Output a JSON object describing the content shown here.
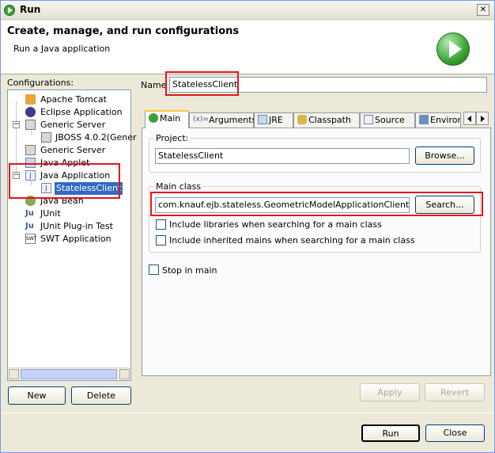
{
  "window": {
    "title": "Run",
    "close_glyph": "✕"
  },
  "header": {
    "title": "Create, manage, and run configurations",
    "subtitle": "Run a Java application",
    "icon": "run-icon"
  },
  "left": {
    "configurations_label": "Configurations:",
    "items": [
      {
        "label": "Apache Tomcat",
        "icon": "tomcat-icon"
      },
      {
        "label": "Eclipse Application",
        "icon": "eclipse-icon"
      },
      {
        "label": "Generic Server",
        "icon": "server-icon"
      },
      {
        "label": "JBOSS 4.0.2(Gener",
        "icon": "server-icon"
      },
      {
        "label": "Generic Server",
        "icon": "server-icon"
      },
      {
        "label": "Java Applet",
        "icon": "applet-icon"
      },
      {
        "label": "Java Application",
        "icon": "java-app-icon"
      },
      {
        "label": "StatelessClient",
        "icon": "java-app-icon"
      },
      {
        "label": "Java Bean",
        "icon": "bean-icon"
      },
      {
        "label": "JUnit",
        "icon": "junit-icon"
      },
      {
        "label": "JUnit Plug-in Test",
        "icon": "junit-icon"
      },
      {
        "label": "SWT Application",
        "icon": "swt-icon"
      }
    ],
    "new_label": "New",
    "delete_label": "Delete"
  },
  "form": {
    "name_label": "Name",
    "name_value": "StatelessClient",
    "tabs": [
      {
        "label": "Main",
        "icon": "main-tab-icon"
      },
      {
        "label": "Arguments",
        "icon": "arguments-icon"
      },
      {
        "label": "JRE",
        "icon": "jre-icon"
      },
      {
        "label": "Classpath",
        "icon": "classpath-icon"
      },
      {
        "label": "Source",
        "icon": "source-icon"
      },
      {
        "label": "Environ",
        "icon": "environment-icon"
      }
    ],
    "project_label": "Project:",
    "project_value": "StatelessClient",
    "browse_label": "Browse...",
    "main_class_label": "Main class",
    "main_class_value": "com.knauf.ejb.stateless.GeometricModelApplicationClient",
    "search_label": "Search...",
    "include_libraries": "Include libraries when searching for a main class",
    "include_inherited": "Include inherited mains when searching for a main class",
    "stop_in_main": "Stop in main",
    "apply_label": "Apply",
    "revert_label": "Revert"
  },
  "footer": {
    "run_label": "Run",
    "close_label": "Close"
  },
  "colors": {
    "highlight": "#e3161b",
    "selection": "#316ac5"
  }
}
